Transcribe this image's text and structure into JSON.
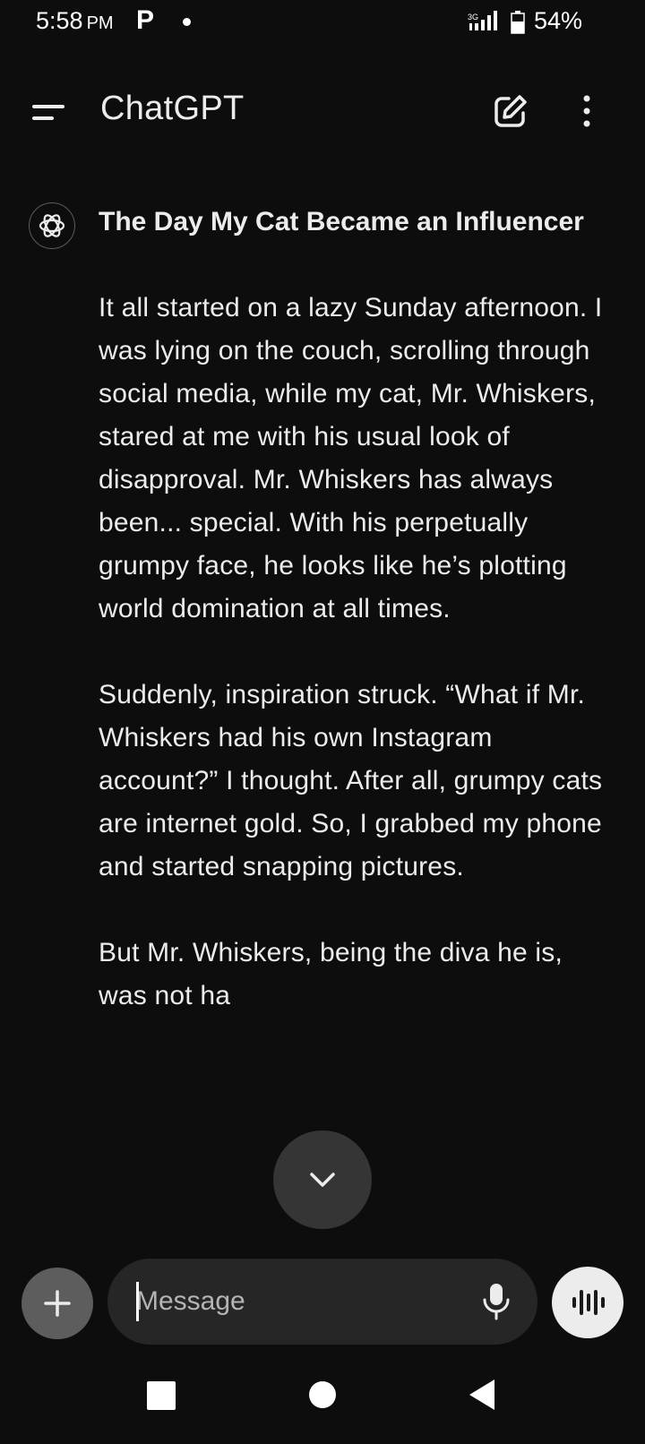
{
  "status_bar": {
    "time": "5:58",
    "ampm": "PM",
    "notification_app": "P",
    "network": "3G",
    "battery": "54%"
  },
  "app_bar": {
    "title": "ChatGPT"
  },
  "message": {
    "title": "The Day My Cat Became an Influencer",
    "paragraphs": [
      "It all started on a lazy Sunday afternoon. I was lying on the couch, scrolling through social media, while my cat, Mr. Whiskers, stared at me with his usual look of disapproval. Mr. Whiskers has always been... special. With his perpetually grumpy face, he looks like he’s plotting world domination at all times.",
      "Suddenly, inspiration struck. “What if Mr. Whiskers had his own Instagram account?” I thought. After all, grumpy cats are internet gold. So, I grabbed my phone and started snapping pictures.",
      "But Mr. Whiskers, being the diva he is, was not ha"
    ]
  },
  "composer": {
    "placeholder": "Message"
  },
  "icons": {
    "menu": "menu-icon",
    "new_chat": "edit-icon",
    "more": "more-vertical-icon",
    "avatar": "openai-logo-icon",
    "scroll_down": "chevron-down-icon",
    "attach": "plus-icon",
    "mic": "microphone-icon",
    "voice": "voice-waveform-icon"
  },
  "colors": {
    "background": "#0d0d0d",
    "text": "#ececec",
    "input_background": "#262626",
    "attach_button": "#5d5d5d",
    "scroll_button": "#353535"
  }
}
